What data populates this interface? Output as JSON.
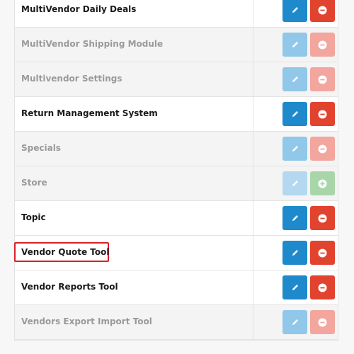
{
  "extensions": [
    {
      "name": "MultiVendor Daily Deals",
      "state": "enabled",
      "action": "remove"
    },
    {
      "name": "MultiVendor Shipping Module",
      "state": "disabled",
      "action": "remove"
    },
    {
      "name": "Multivendor Settings",
      "state": "disabled",
      "action": "remove"
    },
    {
      "name": "Return Management System",
      "state": "enabled",
      "action": "remove"
    },
    {
      "name": "Specials",
      "state": "disabled",
      "action": "remove"
    },
    {
      "name": "Store",
      "state": "disabled",
      "action": "install"
    },
    {
      "name": "Topic",
      "state": "enabled",
      "action": "remove"
    },
    {
      "name": "Vendor Quote Tool",
      "state": "enabled",
      "action": "remove",
      "highlighted": true
    },
    {
      "name": "Vendor Reports Tool",
      "state": "enabled",
      "action": "remove"
    },
    {
      "name": "Vendors Export Import Tool",
      "state": "disabled",
      "action": "remove"
    }
  ],
  "colors": {
    "edit": "#1e8acb",
    "remove": "#e2432f",
    "install": "#59b55b",
    "highlight": "#d92027"
  },
  "icons": {
    "edit": "pencil-icon",
    "remove": "minus-circle-icon",
    "install": "plus-circle-icon"
  }
}
